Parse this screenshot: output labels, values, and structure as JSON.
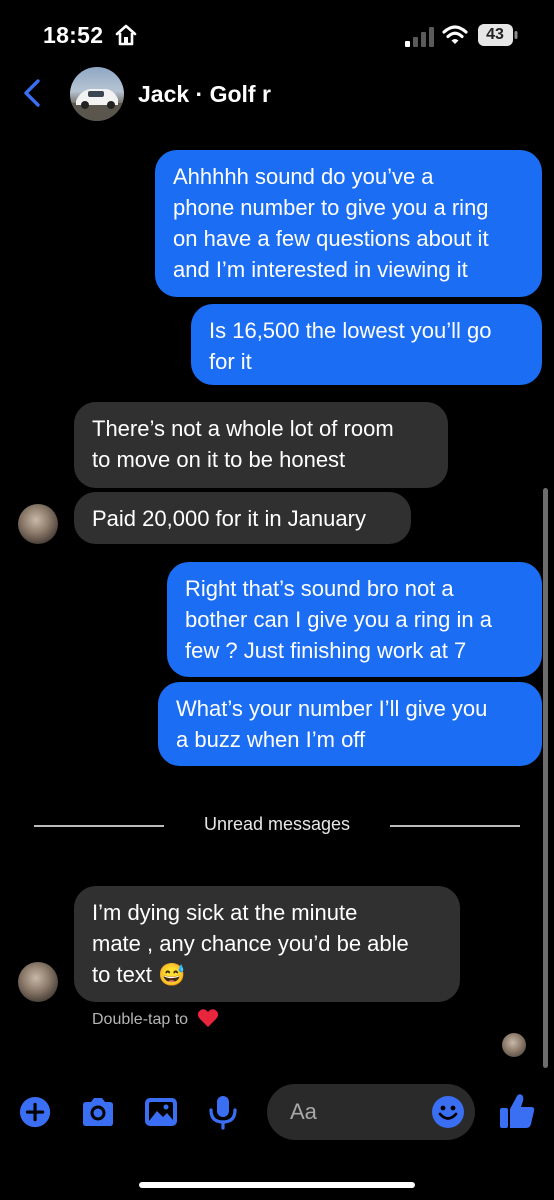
{
  "status": {
    "time": "18:52",
    "battery": "43",
    "icons": [
      "home-icon",
      "signal-icon",
      "wifi-icon",
      "battery-icon"
    ]
  },
  "header": {
    "contact_name": "Jack · Golf r",
    "icons": [
      "back-icon"
    ]
  },
  "messages": [
    {
      "from": "me",
      "text": "Ahhhhh sound do you’ve a\nphone number to give you a ring\non have a few questions about it\nand I’m interested in viewing it"
    },
    {
      "from": "me",
      "text": "Is 16,500 the lowest you’ll go\nfor it"
    },
    {
      "from": "them",
      "text": "There’s not a whole lot of room\nto move on it to be honest"
    },
    {
      "from": "them",
      "text": "Paid 20,000 for it in January"
    },
    {
      "from": "me",
      "text": "Right that’s sound bro not a\nbother can I give you a ring in a\nfew ? Just finishing work at 7"
    },
    {
      "from": "me",
      "text": "What’s your number I’ll give you\na buzz when I’m off"
    },
    {
      "from": "them",
      "text": "I’m dying sick at the minute\nmate , any chance you’d be able\nto text 😅"
    }
  ],
  "divider": {
    "label": "Unread messages"
  },
  "reaction_hint": "Double-tap to",
  "composer": {
    "placeholder": "Aa",
    "icons": [
      "plus-icon",
      "camera-icon",
      "gallery-icon",
      "microphone-icon",
      "emoji-icon",
      "thumbs-up-icon"
    ]
  },
  "colors": {
    "accent": "#1b6ef3",
    "sent_bubble": "#1b6ef3",
    "received_bubble": "#303030",
    "icon_blue": "#3a6ff3",
    "background": "#000000",
    "heart": "#e8253d"
  }
}
